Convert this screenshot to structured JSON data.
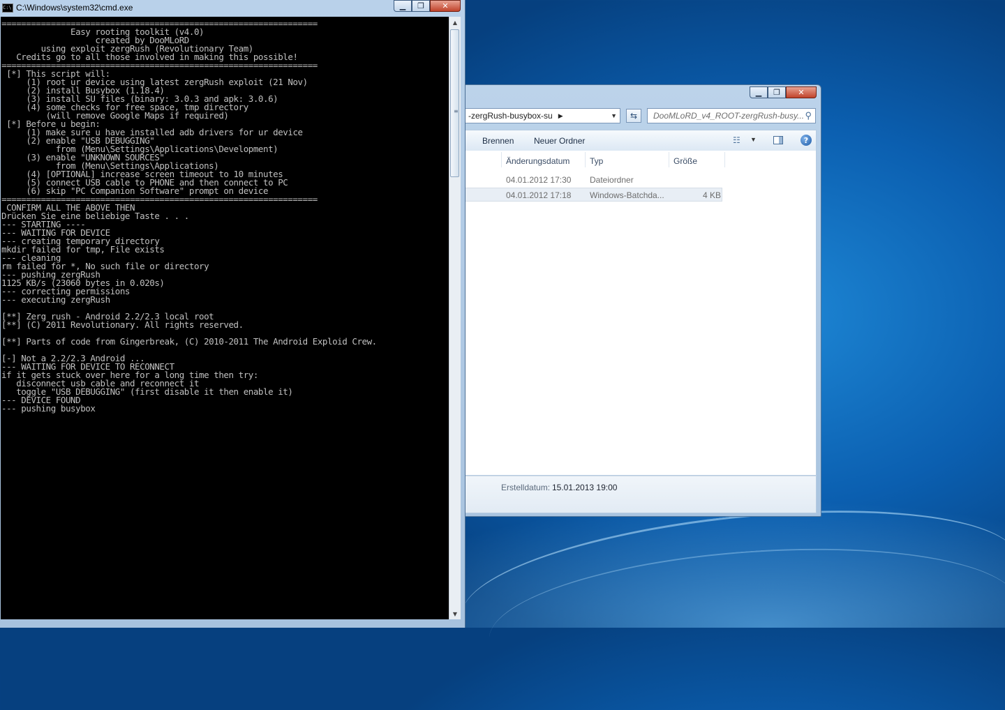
{
  "cmd_window": {
    "title": "C:\\Windows\\system32\\cmd.exe",
    "icon_label": "C:\\",
    "minimize": "▁",
    "maximize": "❐",
    "close": "✕",
    "console_lines": [
      "================================================================",
      "              Easy rooting toolkit (v4.0)",
      "                   created by DooMLoRD",
      "        using exploit zergRush (Revolutionary Team)",
      "   Credits go to all those involved in making this possible!",
      "================================================================",
      " [*] This script will:",
      "     (1) root ur device using latest zergRush exploit (21 Nov)",
      "     (2) install Busybox (1.18.4)",
      "     (3) install SU files (binary: 3.0.3 and apk: 3.0.6)",
      "     (4) some checks for free space, tmp directory",
      "         (will remove Google Maps if required)",
      " [*] Before u begin:",
      "     (1) make sure u have installed adb drivers for ur device",
      "     (2) enable \"USB DEBUGGING\"",
      "           from (Menu\\Settings\\Applications\\Development)",
      "     (3) enable \"UNKNOWN SOURCES\"",
      "           from (Menu\\Settings\\Applications)",
      "     (4) [OPTIONAL] increase screen timeout to 10 minutes",
      "     (5) connect USB cable to PHONE and then connect to PC",
      "     (6) skip \"PC Companion Software\" prompt on device",
      "================================================================",
      " CONFIRM ALL THE ABOVE THEN",
      "Drücken Sie eine beliebige Taste . . .",
      "--- STARTING ----",
      "--- WAITING FOR DEVICE",
      "--- creating temporary directory",
      "mkdir failed for tmp, File exists",
      "--- cleaning",
      "rm failed for *, No such file or directory",
      "--- pushing zergRush",
      "1125 KB/s (23060 bytes in 0.020s)",
      "--- correcting permissions",
      "--- executing zergRush",
      "",
      "[**] Zerg rush - Android 2.2/2.3 local root",
      "[**] (C) 2011 Revolutionary. All rights reserved.",
      "",
      "[**] Parts of code from Gingerbreak, (C) 2010-2011 The Android Exploid Crew.",
      "",
      "[-] Not a 2.2/2.3 Android ...",
      "--- WAITING FOR DEVICE TO RECONNECT",
      "if it gets stuck over here for a long time then try:",
      "   disconnect usb cable and reconnect it",
      "   toggle \"USB DEBUGGING\" (first disable it then enable it)",
      "--- DEVICE FOUND",
      "--- pushing busybox"
    ],
    "scrollbar": {
      "up": "▲",
      "down": "▼",
      "grip": "≡"
    }
  },
  "explorer_window": {
    "minimize": "▁",
    "maximize": "❐",
    "close": "✕",
    "address": "-zergRush-busybox-su",
    "address_arrow": "▶",
    "address_dropdown": "▼",
    "refresh_icon": "⇆",
    "search_placeholder": "DooMLoRD_v4_ROOT-zergRush-busy...",
    "search_icon": "⚲",
    "toolbar": {
      "burn": "Brennen",
      "new_folder": "Neuer Ordner",
      "view_icon": "☷",
      "view_dropdown": "▼",
      "help": "?"
    },
    "columns": [
      "Änderungsdatum",
      "Typ",
      "Größe"
    ],
    "rows": [
      {
        "date": "04.01.2012 17:30",
        "type": "Dateiordner",
        "size": ""
      },
      {
        "date": "04.01.2012 17:18",
        "type": "Windows-Batchda...",
        "size": "4 KB"
      }
    ],
    "details": {
      "label": "Erstelldatum:",
      "value": "15.01.2013 19:00"
    }
  }
}
